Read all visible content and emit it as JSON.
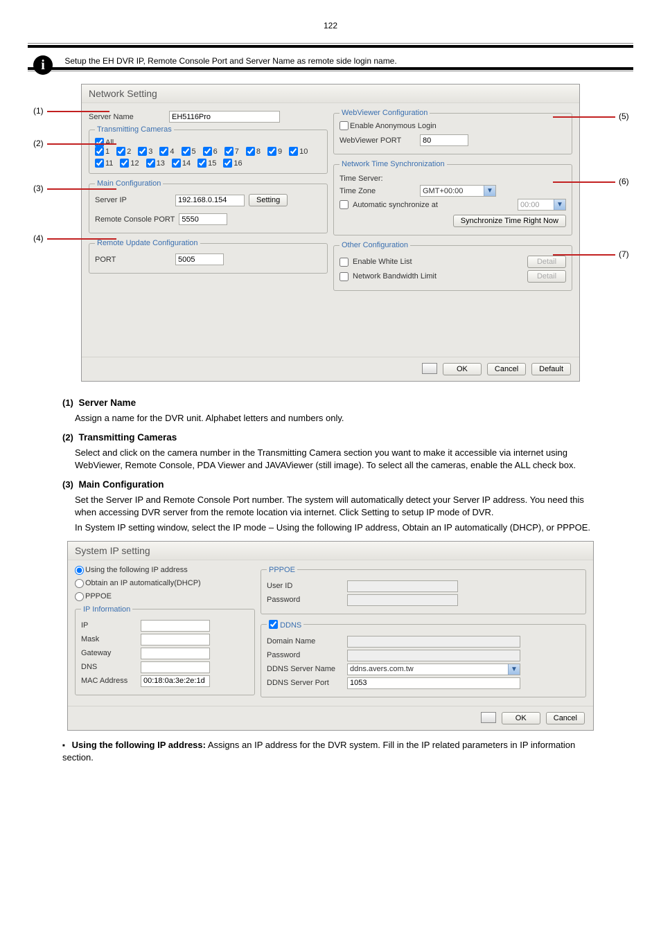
{
  "info_glyph": "i",
  "info_text": "Setup the EH DVR IP, Remote Console Port and Server Name as remote side login name.",
  "dialog1": {
    "title": "Network Setting",
    "serverName_label": "Server Name",
    "serverName_value": "EH5116Pro",
    "trans_legend": "Transmitting Cameras",
    "all_label": "All",
    "main_legend": "Main Configuration",
    "serverIP_label": "Server IP",
    "serverIP_value": "192.168.0.154",
    "setting_btn": "Setting",
    "remoteConsole_label": "Remote Console PORT",
    "remoteConsole_value": "5550",
    "remoteUpdate_legend": "Remote Update Configuration",
    "port_label": "PORT",
    "port_value": "5005",
    "webviewer_legend": "WebViewer Configuration",
    "anonLogin_label": "Enable Anonymous Login",
    "webviewerPort_label": "WebViewer PORT",
    "webviewerPort_value": "80",
    "nts_legend": "Network Time Synchronization",
    "timeServer_label": "Time Server:",
    "timeZone_label": "Time Zone",
    "timeZone_value": "GMT+00:00",
    "autoSync_label": "Automatic synchronize at",
    "autoSync_value": "00:00",
    "syncNow_btn": "Synchronize Time Right Now",
    "other_legend": "Other Configuration",
    "whitelist_label": "Enable White List",
    "bandwidth_label": "Network Bandwidth Limit",
    "detail_btn": "Detail",
    "ok": "OK",
    "cancel": "Cancel",
    "default": "Default",
    "callouts": {
      "c1": "(1)",
      "c2": "(2)",
      "c3": "(3)",
      "c4": "(4)",
      "c5": "(5)",
      "c6": "(6)",
      "c7": "(7)"
    }
  },
  "section": {
    "num1": "(1)",
    "title1": "Server Name",
    "body1": "Assign a name for the DVR unit. Alphabet letters and numbers only.",
    "num2": "(2)",
    "title2": "Transmitting Cameras",
    "body2": "Select and click on the camera number in the Transmitting Camera section you want to make it accessible via internet using WebViewer, Remote Console, PDA Viewer and JAVAViewer (still image). To select all the cameras, enable the ALL check box.",
    "num3": "(3)",
    "title3": "Main Configuration",
    "body3a": "Set the Server IP and Remote Console Port number. The system will automatically detect your Server IP address. You need this when accessing DVR server from the remote location via internet. Click Setting to setup IP mode of DVR.",
    "body3b": "In System IP setting window, select the IP mode – Using the following IP address, Obtain an IP automatically (DHCP), or PPPOE."
  },
  "dialog2": {
    "title": "System IP setting",
    "radio1": "Using the following IP address",
    "radio2": "Obtain an IP automatically(DHCP)",
    "radio3": "PPPOE",
    "ipinfo_legend": "IP Information",
    "ip_label": "IP",
    "mask_label": "Mask",
    "gateway_label": "Gateway",
    "dns_label": "DNS",
    "mac_label": "MAC Address",
    "mac_value": "00:18:0a:3e:2e:1d",
    "pppoe_legend": "PPPOE",
    "userid_label": "User ID",
    "password_label": "Password",
    "ddns_legend": "DDNS",
    "domain_label": "Domain Name",
    "ddns_password_label": "Password",
    "ddns_server_label": "DDNS Server Name",
    "ddns_server_value": "ddns.avers.com.tw",
    "ddns_port_label": "DDNS Server Port",
    "ddns_port_value": "1053",
    "ok": "OK",
    "cancel": "Cancel"
  },
  "item_using": {
    "heading": "Using the following IP address:",
    "body": "Assigns an IP address for the DVR system. Fill in the IP related parameters in IP information section."
  },
  "pagenum": "122"
}
